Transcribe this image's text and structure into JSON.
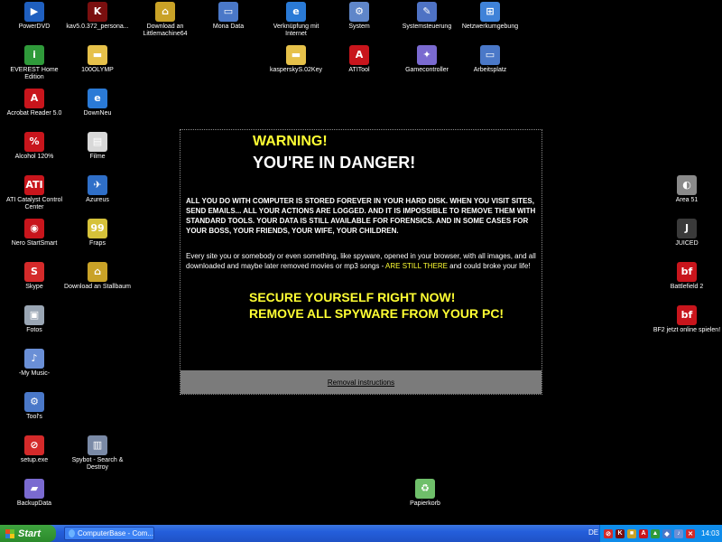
{
  "desktop_icons": [
    {
      "label": "PowerDVD",
      "icon": "powerdvd-icon",
      "color": "#1f5fbf",
      "glyph": "▶"
    },
    {
      "label": "kav5.0.372_persona...",
      "icon": "kaspersky-box-icon",
      "color": "#7a0f0f",
      "glyph": "K"
    },
    {
      "label": "Download an Littlemachine64",
      "icon": "network-share-icon",
      "color": "#c9a227",
      "glyph": "⌂"
    },
    {
      "label": "Mona Data",
      "icon": "computer-icon",
      "color": "#4a78c8",
      "glyph": "▭"
    },
    {
      "label": "Verknüpfung mit Internet",
      "icon": "internet-explorer-icon",
      "color": "#2a7ad6",
      "glyph": "e"
    },
    {
      "label": "System",
      "icon": "system-icon",
      "color": "#5f86c9",
      "glyph": "⚙"
    },
    {
      "label": "Systemsteuerung",
      "icon": "control-panel-icon",
      "color": "#4e72c4",
      "glyph": "✎"
    },
    {
      "label": "Netzwerkumgebung",
      "icon": "network-icon",
      "color": "#3f82d8",
      "glyph": "⊞"
    },
    {
      "label": "EVEREST Home Edition",
      "icon": "everest-icon",
      "color": "#2f9a3a",
      "glyph": "i"
    },
    {
      "label": "100OLYMP",
      "icon": "folder-icon",
      "color": "#e6c14a",
      "glyph": "▬"
    },
    {
      "label": "kasperskyS.02Key",
      "icon": "folder-icon",
      "color": "#e6c14a",
      "glyph": "▬"
    },
    {
      "label": "ATITool",
      "icon": "ati-tool-icon",
      "color": "#c8151c",
      "glyph": "A"
    },
    {
      "label": "Gamecontroller",
      "icon": "gamecontroller-icon",
      "color": "#7a6ad0",
      "glyph": "✦"
    },
    {
      "label": "Arbeitsplatz",
      "icon": "my-computer-icon",
      "color": "#4a78c8",
      "glyph": "▭"
    },
    {
      "label": "Acrobat Reader 5.0",
      "icon": "acrobat-icon",
      "color": "#c8151c",
      "glyph": "A"
    },
    {
      "label": "DownNeu",
      "icon": "internet-explorer-icon",
      "color": "#2a7ad6",
      "glyph": "e"
    },
    {
      "label": "Alcohol 120%",
      "icon": "alcohol-icon",
      "color": "#c8151c",
      "glyph": "%"
    },
    {
      "label": "Filme",
      "icon": "presentation-icon",
      "color": "#d8d8d8",
      "glyph": "▤"
    },
    {
      "label": "ATI Catalyst Control Center",
      "icon": "ati-catalyst-icon",
      "color": "#c8151c",
      "glyph": "ATI"
    },
    {
      "label": "Azureus",
      "icon": "azureus-icon",
      "color": "#2f6fc8",
      "glyph": "✈"
    },
    {
      "label": "Nero StartSmart",
      "icon": "nero-icon",
      "color": "#c8151c",
      "glyph": "◉"
    },
    {
      "label": "Fraps",
      "icon": "fraps-icon",
      "color": "#d6c23a",
      "glyph": "99"
    },
    {
      "label": "Skype",
      "icon": "skype-icon",
      "color": "#d42a2a",
      "glyph": "S"
    },
    {
      "label": "Download an Stallbaum",
      "icon": "network-share-icon",
      "color": "#c9a227",
      "glyph": "⌂"
    },
    {
      "label": "Fotos",
      "icon": "photos-icon",
      "color": "#9aa6b4",
      "glyph": "▣"
    },
    {
      "label": "-My Music-",
      "icon": "music-icon",
      "color": "#6a8fd6",
      "glyph": "♪"
    },
    {
      "label": "Tool's",
      "icon": "tools-gear-icon",
      "color": "#4a78c8",
      "glyph": "⚙"
    },
    {
      "label": "setup.exe",
      "icon": "setup-blocked-icon",
      "color": "#d42a2a",
      "glyph": "⊘"
    },
    {
      "label": "Spybot - Search & Destroy",
      "icon": "spybot-icon",
      "color": "#7a8aa6",
      "glyph": "▥"
    },
    {
      "label": "BackupData",
      "icon": "backup-drive-icon",
      "color": "#7a6ad0",
      "glyph": "▰"
    },
    {
      "label": "Papierkorb",
      "icon": "recycle-bin-icon",
      "color": "#6fbf6a",
      "glyph": "♻"
    },
    {
      "label": "Area 51",
      "icon": "area51-icon",
      "color": "#8a8a8a",
      "glyph": "◐"
    },
    {
      "label": "JUICED",
      "icon": "juiced-icon",
      "color": "#3a3a3a",
      "glyph": "J"
    },
    {
      "label": "Battlefield 2",
      "icon": "battlefield-icon",
      "color": "#c8151c",
      "glyph": "bf"
    },
    {
      "label": "BF2 jetzt online spielen!",
      "icon": "battlefield-online-icon",
      "color": "#c8151c",
      "glyph": "bf"
    }
  ],
  "popup": {
    "warning": "WARNING!",
    "danger": "YOU'RE IN DANGER!",
    "paragraph1": "ALL YOU DO WITH COMPUTER IS STORED FOREVER IN YOUR HARD DISK. WHEN YOU VISIT SITES, SEND EMAILS... ALL YOUR ACTIONS ARE LOGGED. AND IT IS IMPOSSIBLE TO REMOVE THEM WITH STANDARD TOOLS. YOUR DATA IS STILL AVAILABLE FOR FORENSICS. AND IN SOME CASES FOR YOUR BOSS, YOUR FRIENDS, YOUR WIFE, YOUR CHILDREN.",
    "paragraph2_part1": "Every site you or somebody or even something, like spyware, opened in your browser, with all images, and all downloaded and maybe later removed movies or mp3 songs - ",
    "paragraph2_highlight": "ARE STILL THERE",
    "paragraph2_part2": " and could broke your life!",
    "secure_line": "SECURE YOURSELF RIGHT NOW!",
    "remove_line": "REMOVE ALL SPYWARE FROM YOUR PC!",
    "removal_link": "Removal instructions"
  },
  "taskbar": {
    "start_label": "Start",
    "task_label": "ComputerBase - Com...",
    "language": "DE",
    "clock": "14:03",
    "tray_icons": [
      {
        "icon": "tray-icon-1",
        "color": "#d42a2a",
        "glyph": "⊘"
      },
      {
        "icon": "tray-kaspersky-icon",
        "color": "#7a0f0f",
        "glyph": "K"
      },
      {
        "icon": "tray-icon-3",
        "color": "#c9a227",
        "glyph": "■"
      },
      {
        "icon": "tray-icon-4",
        "color": "#c8151c",
        "glyph": "A"
      },
      {
        "icon": "tray-icon-5",
        "color": "#2f9a3a",
        "glyph": "▲"
      },
      {
        "icon": "tray-icon-6",
        "color": "#4a78c8",
        "glyph": "◆"
      },
      {
        "icon": "tray-icon-7",
        "color": "#6a8fd6",
        "glyph": "♪"
      },
      {
        "icon": "tray-alert-icon",
        "color": "#d42a2a",
        "glyph": "✕"
      }
    ]
  },
  "colors": {
    "desktop_background": "#000000",
    "warning_yellow": "#ffff33",
    "taskbar_blue": "#245edb",
    "start_green": "#2b8a2b"
  }
}
